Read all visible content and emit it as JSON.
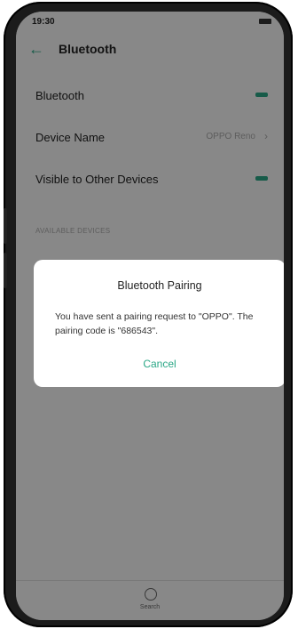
{
  "status_bar": {
    "time": "19:30"
  },
  "header": {
    "title": "Bluetooth",
    "back_icon": "arrow-left-icon"
  },
  "settings": [
    {
      "label": "Bluetooth",
      "toggle": "on"
    },
    {
      "label": "Device Name",
      "value": "OPPO Reno"
    },
    {
      "label": "Visible to Other Devices",
      "toggle": "on"
    }
  ],
  "section_header": "AVAILABLE DEVICES",
  "dialog": {
    "title": "Bluetooth Pairing",
    "message": "You have sent a pairing request to \"OPPO\". The pairing code is \"686543\".",
    "cancel_label": "Cancel"
  },
  "bottom_bar": {
    "search_label": "Search",
    "search_icon": "refresh-search-icon"
  },
  "colors": {
    "accent": "#2aa786",
    "overlay": "rgba(0,0,0,0.45)"
  }
}
